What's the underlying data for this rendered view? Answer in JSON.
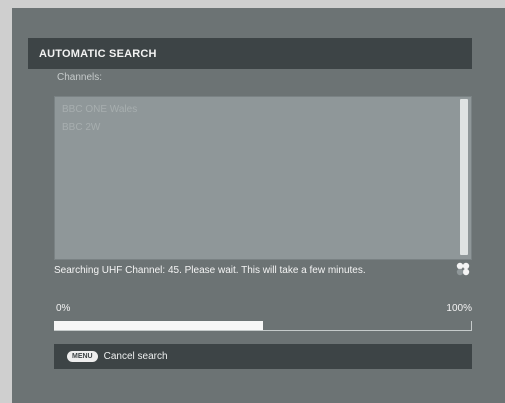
{
  "dialog": {
    "title": "AUTOMATIC SEARCH",
    "channels_label": "Channels:",
    "channels": [
      "BBC ONE Wales",
      "BBC 2W"
    ],
    "status_text": "Searching UHF Channel: 45. Please wait. This will take a few minutes.",
    "progress": {
      "start_label": "0%",
      "end_label": "100%",
      "fraction": 0.5
    },
    "footer": {
      "key_label": "MENU",
      "action_label": "Cancel search"
    }
  },
  "icons": {
    "busy": "spinner-icon"
  },
  "colors": {
    "background": "#6c7374",
    "bar": "#3d4446",
    "list": "#8f9799",
    "progress_fill": "#f7f7f7"
  }
}
